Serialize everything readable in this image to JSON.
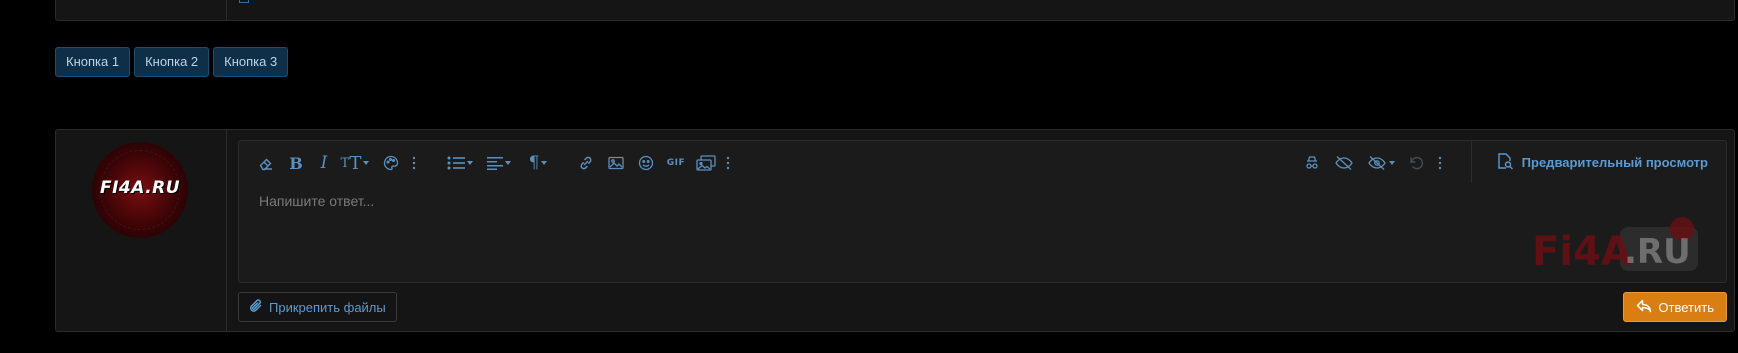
{
  "custom_buttons": [
    {
      "label": "Кнопка 1"
    },
    {
      "label": "Кнопка 2"
    },
    {
      "label": "Кнопка 3"
    }
  ],
  "avatar": {
    "text": "FI4A.RU"
  },
  "editor": {
    "placeholder": "Напишите ответ...",
    "preview_label": "Предварительный просмотр",
    "toolbar_icons": [
      "eraser-icon",
      "bold-icon",
      "italic-icon",
      "text-size-icon",
      "palette-icon",
      "more-options-icon",
      "list-icon",
      "align-icon",
      "paragraph-icon",
      "link-icon",
      "image-icon",
      "emoji-icon",
      "gif-icon",
      "media-gallery-icon",
      "more-options-icon",
      "incognito-icon",
      "hide-icon",
      "hide-options-icon",
      "undo-icon",
      "more-options-icon",
      "preview-icon"
    ],
    "gif_label": "GIF"
  },
  "watermark": {
    "text_left": "Fi4A",
    "text_right": ".RU"
  },
  "footer": {
    "attach_label": "Прикрепить файлы",
    "submit_label": "Ответить"
  },
  "colors": {
    "accent": "#5b8fbd",
    "submit": "#d97e12",
    "custom_button_bg": "#0f2f48",
    "watermark": "#6a0f13"
  }
}
